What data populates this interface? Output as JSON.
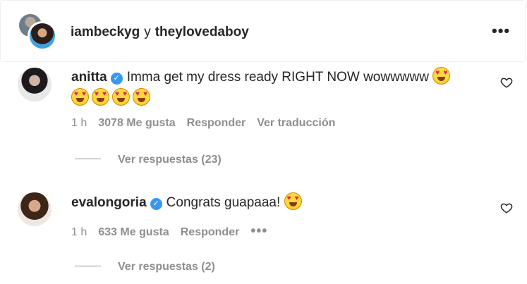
{
  "header": {
    "user1": "iambeckyg",
    "separator": "y",
    "user2": "theylovedaboy",
    "more_icon": "more-horizontal-icon"
  },
  "comments": [
    {
      "username": "anitta",
      "verified": true,
      "text": "Imma get my dress ready RIGHT NOW wowwwww",
      "time": "1 h",
      "likes": "3078 Me gusta",
      "reply": "Responder",
      "translate": "Ver traducción",
      "replies": "Ver respuestas (23)"
    },
    {
      "username": "evalongoria",
      "verified": true,
      "text": "Congrats guapaaa!",
      "time": "1 h",
      "likes": "633 Me gusta",
      "reply": "Responder",
      "more": "•••",
      "replies": "Ver respuestas (2)"
    }
  ],
  "colors": {
    "text": "#262626",
    "secondary": "#8e8e8e",
    "verified": "#3897f0"
  }
}
